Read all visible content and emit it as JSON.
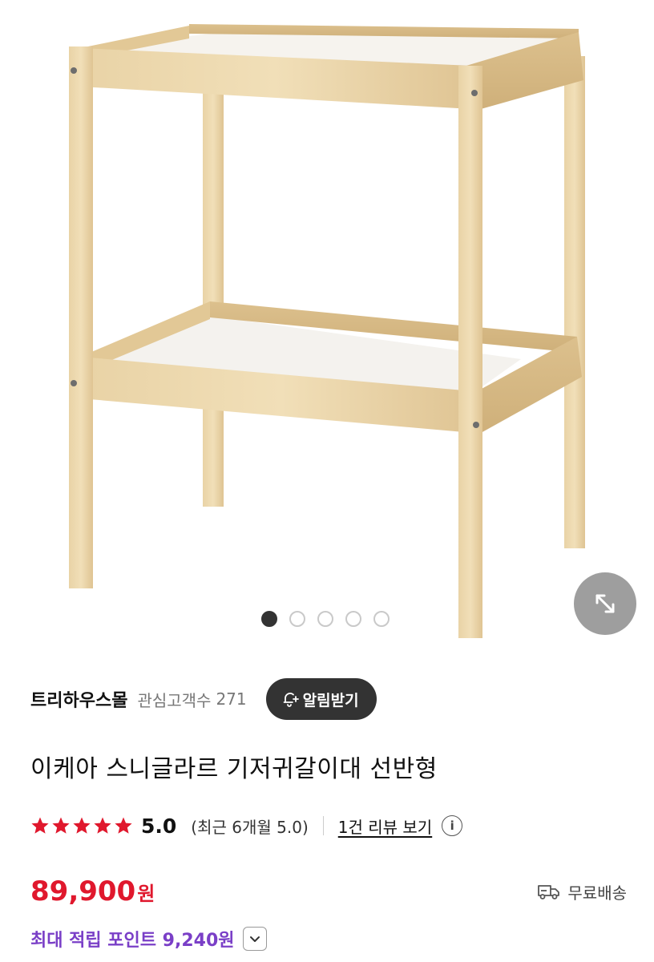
{
  "gallery": {
    "image_alt": "changing table product photo",
    "dot_count": 5,
    "active_dot": 0,
    "expand_icon": "expand-diagonal-icon"
  },
  "seller": {
    "name": "트리하우스몰",
    "fans_label": "관심고객수",
    "fans_count": "271",
    "notify_label": "알림받기",
    "notify_icon": "bell-plus-icon"
  },
  "product": {
    "title": "이케아 스니글라르 기저귀갈이대 선반형"
  },
  "rating": {
    "stars": 5,
    "score": "5.0",
    "recent_text": "(최근 6개월 5.0)",
    "review_link": "1건 리뷰 보기",
    "info_icon": "info-icon",
    "star_color": "#e0182d"
  },
  "price": {
    "amount": "89,900",
    "unit": "원",
    "color": "#e0182d"
  },
  "shipping": {
    "label": "무료배송",
    "icon": "delivery-truck-icon"
  },
  "points": {
    "text": "최대 적립 포인트 9,240원",
    "color": "#7a3fc7",
    "toggle_icon": "chevron-down-icon"
  }
}
